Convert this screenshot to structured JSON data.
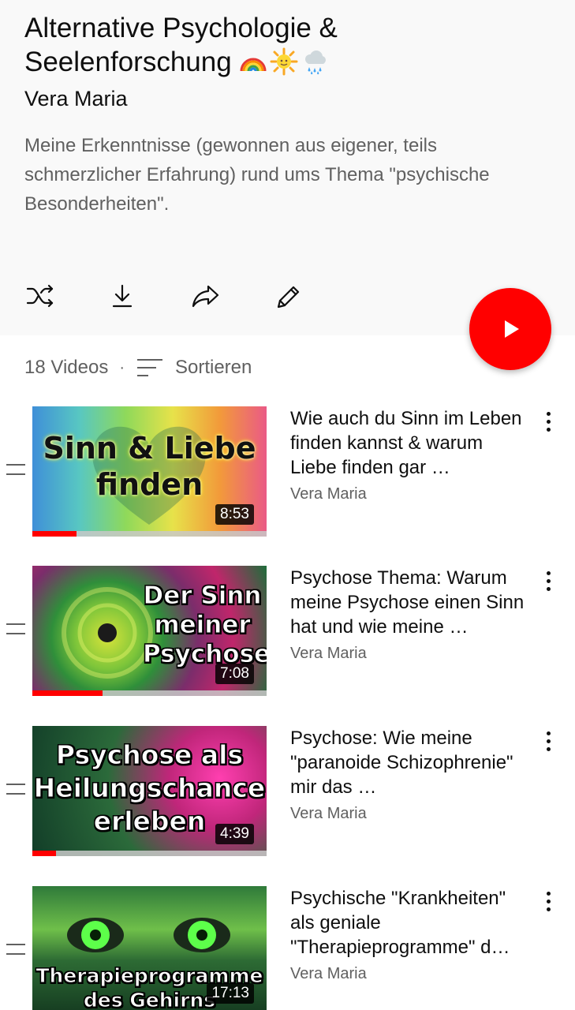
{
  "playlist": {
    "title": "Alternative Psychologie & Seelenforschung",
    "title_emojis": [
      "rainbow-emoji",
      "sun-emoji",
      "rain-cloud-emoji"
    ],
    "owner": "Vera Maria",
    "description": "Meine Erkenntnisse (gewonnen aus eigener, teils schmerzlicher Erfahrung) rund ums Thema \"psychische Besonderheiten\"."
  },
  "actions": [
    {
      "icon": "shuffle-icon"
    },
    {
      "icon": "download-icon"
    },
    {
      "icon": "share-icon"
    },
    {
      "icon": "edit-icon"
    }
  ],
  "play_fab": {
    "icon": "play-icon",
    "color": "#ff0000"
  },
  "list_header": {
    "count": "18 Videos",
    "separator": "·",
    "sort_label": "Sortieren"
  },
  "videos": [
    {
      "thumb_text": "Sinn & Liebe\nfinden",
      "duration": "8:53",
      "progress": 0.19,
      "title": "Wie auch du Sinn im Leben finden kannst & warum Liebe finden gar …",
      "channel": "Vera Maria"
    },
    {
      "thumb_text": "Der Sinn\nmeiner\nPsychose",
      "duration": "7:08",
      "progress": 0.3,
      "title": "Psychose Thema: Warum meine Psychose einen Sinn hat und wie meine …",
      "channel": "Vera Maria"
    },
    {
      "thumb_text": "Psychose als\nHeilungschance\nerleben",
      "duration": "4:39",
      "progress": 0.1,
      "title": "Psychose: Wie meine \"paranoide Schizophrenie\" mir das …",
      "channel": "Vera Maria"
    },
    {
      "thumb_text": "Therapieprogramme\ndes Gehirns",
      "duration": "17:13",
      "progress": 0,
      "title": "Psychische \"Krankheiten\" als geniale \"Therapieprogramme\" d…",
      "channel": "Vera Maria"
    }
  ],
  "colors": {
    "header_bg": "#f9f9f9",
    "accent_red": "#ff0000",
    "secondary_text": "#606060"
  }
}
